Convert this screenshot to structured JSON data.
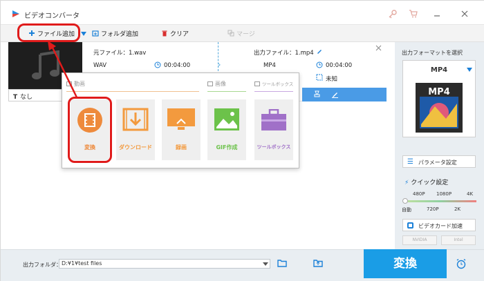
{
  "app": {
    "title": "ビデオコンバータ"
  },
  "toolbar": {
    "add_file": "ファイル追加",
    "add_folder": "フォルダ追加",
    "clear": "クリア",
    "merge": "マージ"
  },
  "file": {
    "source_label": "元ファイル：1.wav",
    "source_format": "WAV",
    "source_duration": "00:04:00",
    "output_label": "出力ファイル：1.mp4",
    "output_format": "MP4",
    "output_duration": "00:04:00",
    "output_size": "未知",
    "subtitle": "なし"
  },
  "popup": {
    "sections": {
      "video": "動画",
      "image": "画像",
      "toolbox": "ツールボックス"
    },
    "tiles": [
      {
        "label": "変換",
        "color": "#ee8a3c"
      },
      {
        "label": "ダウンロード",
        "color": "#f39a3e"
      },
      {
        "label": "録画",
        "color": "#f39a3e"
      },
      {
        "label": "GIF作成",
        "color": "#6cc24a"
      },
      {
        "label": "ツールボックス",
        "color": "#a070c8"
      }
    ]
  },
  "right_panel": {
    "select_format": "出力フォーマットを選択",
    "format": "MP4",
    "format_card_text": "MP4",
    "param_settings": "パラメータ設定",
    "quick_settings": "クイック設定",
    "quality_top": [
      "480P",
      "1080P",
      "4K"
    ],
    "quality_bottom": [
      "自動",
      "720P",
      "2K"
    ],
    "gpu_accel": "ビデオカード加速",
    "gpu_nvidia": "NVIDIA",
    "gpu_intel": "Intel"
  },
  "bottom": {
    "output_folder_label": "出力フォルダ：",
    "output_path": "D:¥1¥test files",
    "convert": "変換"
  },
  "colors": {
    "accent": "#1a9de6",
    "highlight": "#e01b1b",
    "toolbox": "#a070c8"
  }
}
